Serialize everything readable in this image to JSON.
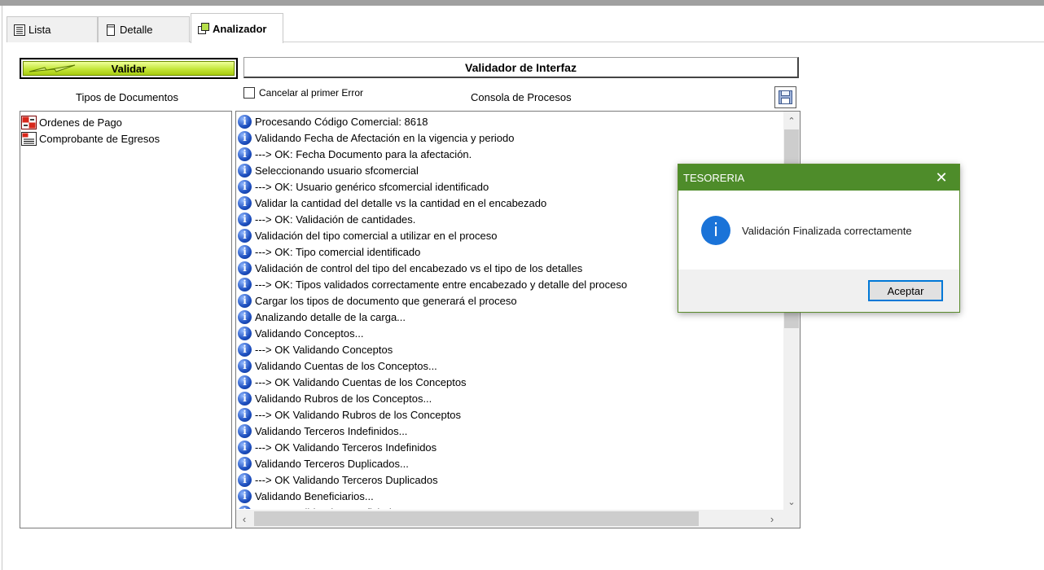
{
  "tabs": [
    {
      "label": "Lista",
      "icon": "list-icon"
    },
    {
      "label": "Detalle",
      "icon": "document-icon"
    },
    {
      "label": "Analizador",
      "icon": "analyzer-icon",
      "active": true
    }
  ],
  "validar_button": {
    "label": "Validar"
  },
  "header": {
    "title": "Validador de Interfaz"
  },
  "labels": {
    "doc_types": "Tipos de Documentos",
    "cancel_first_error": "Cancelar al primer Error",
    "console": "Consola de Procesos"
  },
  "doc_types": [
    {
      "label": "Ordenes de Pago",
      "icon": "payment-order-icon"
    },
    {
      "label": "Comprobante de Egresos",
      "icon": "voucher-icon"
    }
  ],
  "console_lines": [
    "Procesando Código Comercial: 8618",
    "Validando Fecha de Afectación en la vigencia y periodo",
    "---> OK: Fecha Documento para la afectación.",
    "Seleccionando usuario sfcomercial",
    "---> OK: Usuario genérico sfcomercial identificado",
    "Validar la cantidad del detalle vs la cantidad en el encabezado",
    "---> OK: Validación de cantidades.",
    "Validación del tipo comercial a utilizar en el proceso",
    "---> OK: Tipo comercial identificado",
    "Validación de control del tipo del encabezado vs el tipo de los detalles",
    "---> OK: Tipos validados correctamente entre encabezado y detalle del proceso",
    "Cargar los tipos de documento que generará el proceso",
    "Analizando detalle de la carga...",
    "Validando Conceptos...",
    "---> OK Validando Conceptos",
    "Validando Cuentas de los Conceptos...",
    "---> OK Validando Cuentas de los Conceptos",
    "Validando Rubros de los Conceptos...",
    "---> OK Validando Rubros de los Conceptos",
    "Validando Terceros Indefinidos...",
    "---> OK Validando Terceros Indefinidos",
    "Validando Terceros Duplicados...",
    "---> OK Validando Terceros Duplicados",
    "Validando Beneficiarios...",
    "---> OK Validando Beneficiarios"
  ],
  "scroll_arrows": {
    "up": "⌃",
    "down": "⌄",
    "left": "‹",
    "right": "›"
  },
  "dialog": {
    "title": "TESORERIA",
    "message": "Validación Finalizada correctamente",
    "ok_label": "Aceptar",
    "close_glyph": "✕",
    "info_glyph": "i"
  },
  "colors": {
    "dialog_titlebar": "#4e8c2a",
    "validar_green": "#c4e63a",
    "info_blue": "#1a73d8"
  }
}
